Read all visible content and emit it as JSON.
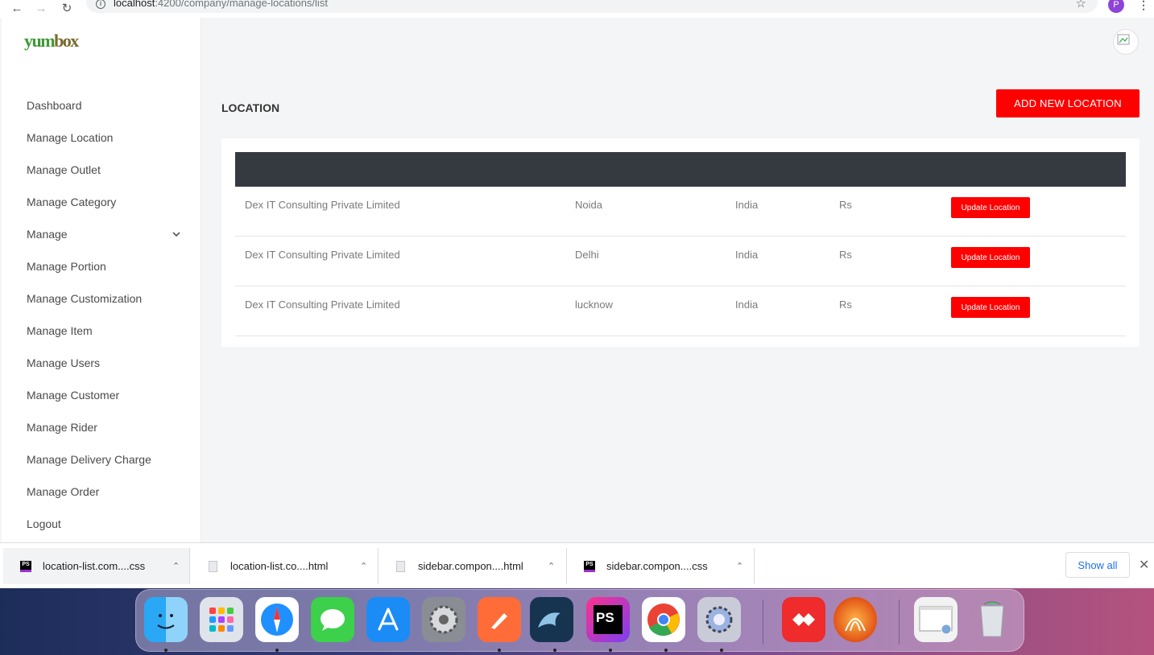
{
  "browser": {
    "url_host": "localhost",
    "url_path": ":4200/company/manage-locations/list",
    "profile_initial": "P"
  },
  "brand": {
    "logo_part1": "yum",
    "logo_part2": "box"
  },
  "sidebar": {
    "items": [
      {
        "label": "Dashboard"
      },
      {
        "label": "Manage Location"
      },
      {
        "label": "Manage Outlet"
      },
      {
        "label": "Manage Category"
      },
      {
        "label": "Manage"
      },
      {
        "label": "Manage Portion"
      },
      {
        "label": "Manage Customization"
      },
      {
        "label": "Manage Item"
      },
      {
        "label": "Manage Users"
      },
      {
        "label": "Manage Customer"
      },
      {
        "label": "Manage Rider"
      },
      {
        "label": "Manage Delivery Charge"
      },
      {
        "label": "Manage Order"
      },
      {
        "label": "Logout"
      }
    ]
  },
  "main": {
    "title": "LOCATION",
    "add_button": "ADD NEW LOCATION",
    "rows": [
      {
        "company": "Dex IT Consulting Private Limited",
        "city": "Noida",
        "country": "India",
        "currency": "Rs",
        "action": "Update Location"
      },
      {
        "company": "Dex IT Consulting Private Limited",
        "city": "Delhi",
        "country": "India",
        "currency": "Rs",
        "action": "Update Location"
      },
      {
        "company": "Dex IT Consulting Private Limited",
        "city": "lucknow",
        "country": "India",
        "currency": "Rs",
        "action": "Update Location"
      }
    ]
  },
  "downloads": {
    "items": [
      {
        "name": "location-list.com....css",
        "type": "phpstorm"
      },
      {
        "name": "location-list.co....html",
        "type": "document"
      },
      {
        "name": "sidebar.compon....html",
        "type": "document"
      },
      {
        "name": "sidebar.compon....css",
        "type": "phpstorm"
      }
    ],
    "show_all": "Show all"
  },
  "dock": {
    "apps": [
      "finder-icon",
      "launchpad-icon",
      "safari-icon",
      "messages-icon",
      "app-store-icon",
      "system-preferences-icon",
      "postman-icon",
      "mysql-workbench-icon",
      "phpstorm-icon",
      "chrome-icon",
      "utility-icon",
      "anydesk-icon",
      "filezilla-icon",
      "preview-icon",
      "trash-icon"
    ],
    "phpstorm_label": "PS"
  },
  "colors": {
    "accent_red": "#ff0000",
    "table_header": "#343a40",
    "brand_green": "#3d9a34"
  }
}
